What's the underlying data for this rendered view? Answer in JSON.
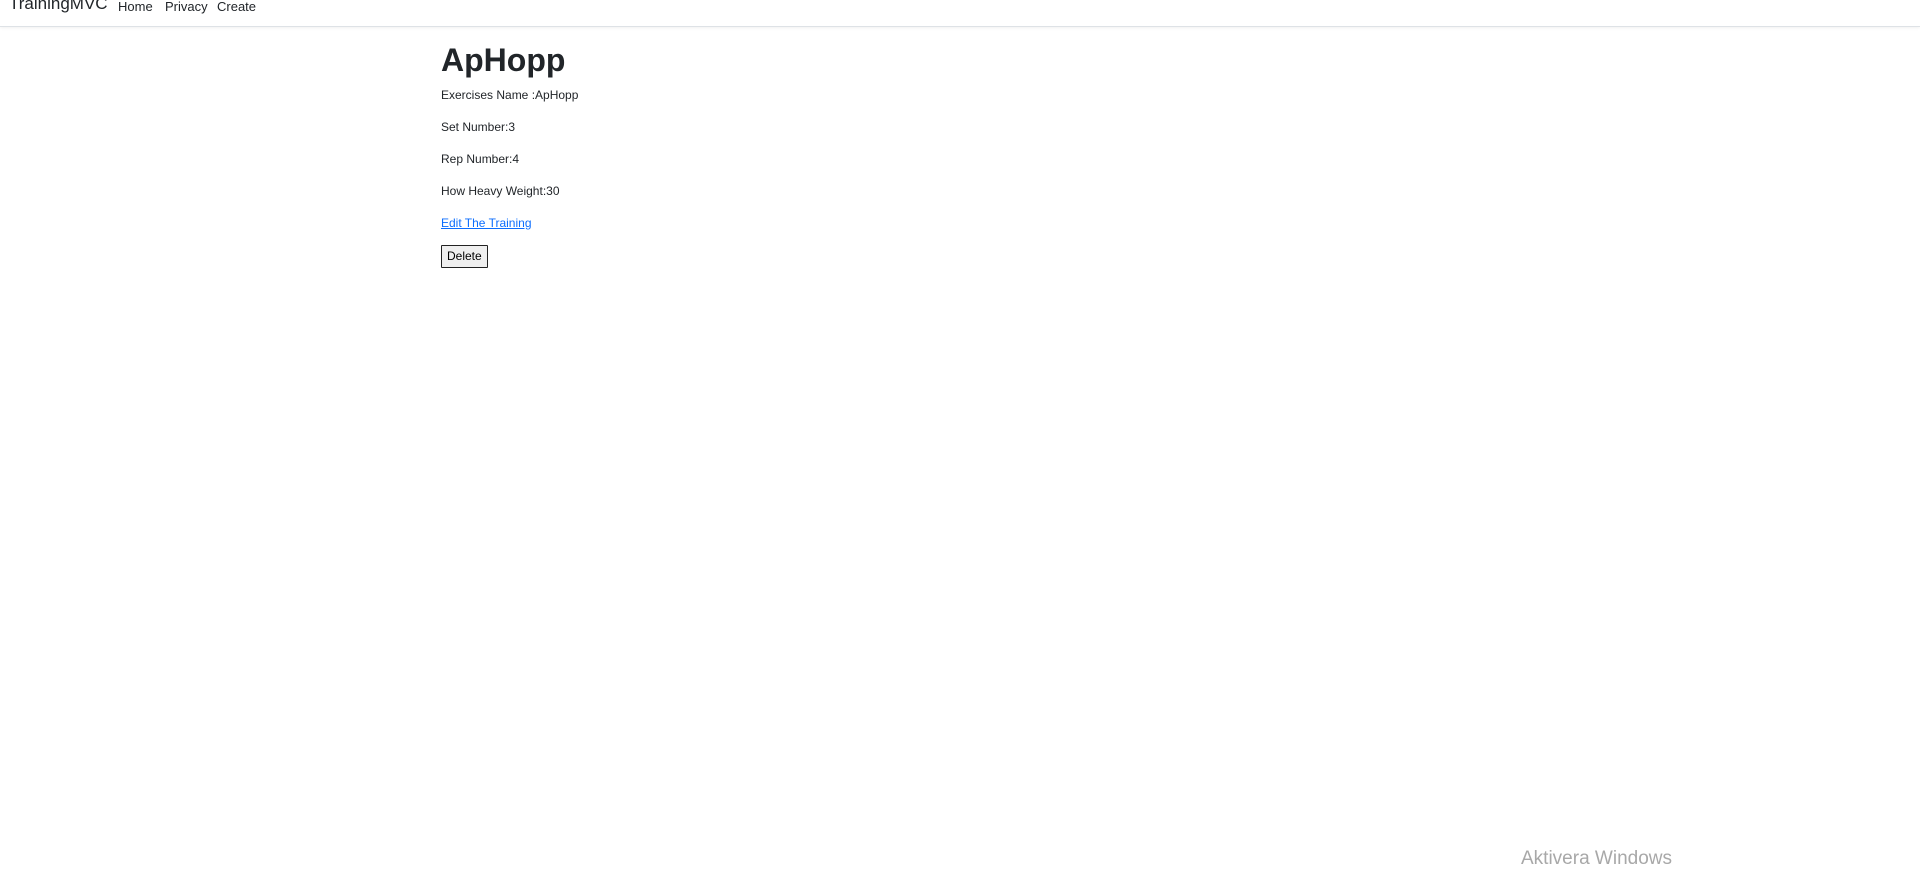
{
  "navbar": {
    "brand": "TrainingMVC",
    "links": [
      {
        "label": "Home"
      },
      {
        "label": "Privacy"
      },
      {
        "label": "Create"
      }
    ]
  },
  "main": {
    "title": "ApHopp",
    "fields": [
      {
        "label": "Exercises Name :ApHopp"
      },
      {
        "label": "Set Number:3"
      },
      {
        "label": "Rep Number:4"
      },
      {
        "label": "How Heavy Weight:30"
      }
    ],
    "edit_link": "Edit The Training",
    "delete_button": "Delete"
  },
  "watermark": "Aktivera Windows",
  "colors": {
    "link": "#0d6efd",
    "text": "#212529",
    "watermark": "#a8a8a8"
  }
}
